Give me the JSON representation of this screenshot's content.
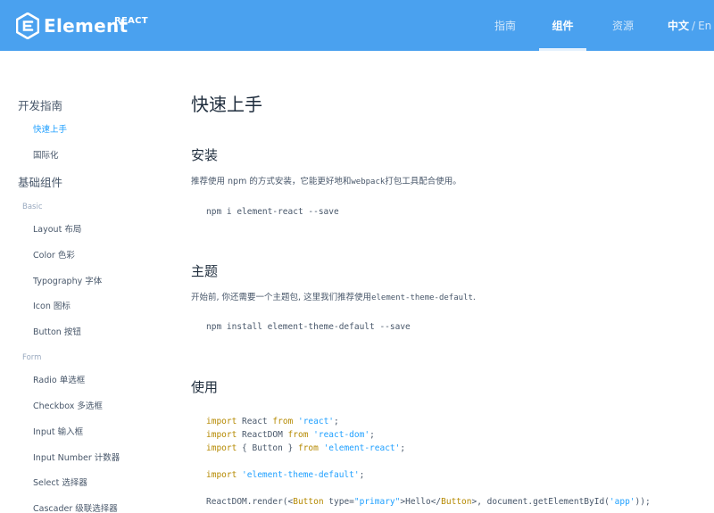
{
  "header": {
    "logo_text": "Element",
    "logo_sup": "REACT",
    "nav": [
      "指南",
      "组件",
      "资源"
    ],
    "active_nav": "组件",
    "lang_zh": "中文",
    "lang_sep": "/",
    "lang_en": "En",
    "colors": {
      "bar": "#4aa1ef",
      "text": "#ffffff"
    }
  },
  "sidebar": {
    "group_guide": "开发指南",
    "guide_items": [
      "快速上手",
      "国际化"
    ],
    "group_components": "基础组件",
    "cat_basic": "Basic",
    "basic_items": [
      "Layout 布局",
      "Color 色彩",
      "Typography 字体",
      "Icon 图标",
      "Button 按钮"
    ],
    "cat_form": "Form",
    "form_items": [
      "Radio 单选框",
      "Checkbox 多选框",
      "Input 输入框",
      "Input Number 计数器",
      "Select 选择器",
      "Cascader 级联选择器"
    ],
    "active_item": "快速上手",
    "active_color": "#20a0ff"
  },
  "main": {
    "title": "快速上手",
    "install_heading": "安装",
    "install_desc_pre": "推荐使用 npm 的方式安装，它能更好地和",
    "install_desc_code": "webpack",
    "install_desc_post": "打包工具配合使用。",
    "install_cmd": "npm i element-react --save",
    "theme_heading": "主题",
    "theme_desc_pre": "开始前, 你还需要一个主题包, 这里我们推荐使用",
    "theme_desc_code": "element-theme-default",
    "theme_desc_post": ".",
    "theme_cmd": "npm install element-theme-default --save",
    "usage_heading": "使用",
    "usage_code": {
      "l1_kw": "import",
      "l1_name": " React ",
      "l1_from": "from",
      "l1_str": " 'react'",
      "l1_end": ";",
      "l2_kw": "import",
      "l2_name": " ReactDOM ",
      "l2_from": "from",
      "l2_str": " 'react-dom'",
      "l2_end": ";",
      "l3_kw": "import",
      "l3_name": " { Button } ",
      "l3_from": "from",
      "l3_str": " 'element-react'",
      "l3_end": ";",
      "l4_kw": "import",
      "l4_str": " 'element-theme-default'",
      "l4_end": ";",
      "l5_a": "ReactDOM.render(<",
      "l5_tag1": "Button",
      "l5_b": " type=",
      "l5_str1": "\"primary\"",
      "l5_c": ">Hello</",
      "l5_tag2": "Button",
      "l5_d": ">, document.getElementById(",
      "l5_str2": "'app'",
      "l5_e": "));"
    }
  }
}
